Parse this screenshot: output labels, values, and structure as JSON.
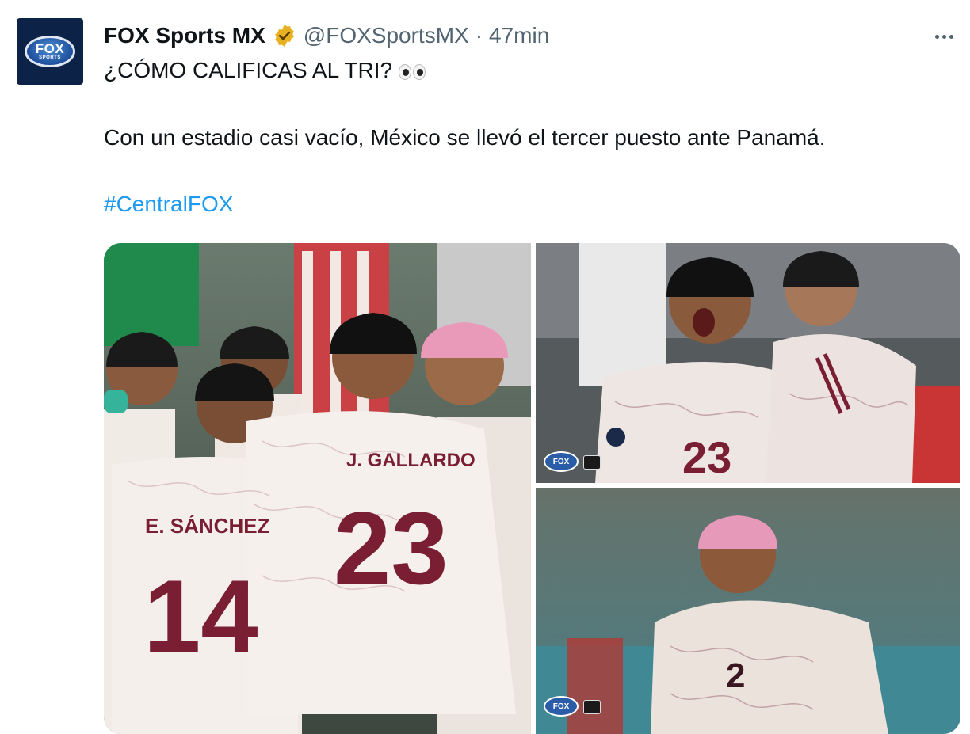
{
  "tweet": {
    "author_name": "FOX Sports MX",
    "handle": "@FOXSportsMX",
    "separator": "·",
    "time": "47min",
    "avatar_logo_text": "FOX",
    "avatar_logo_subtext": "SPORTS",
    "text_line1": "¿CÓMO CALIFICAS AL TRI?",
    "text_line1_emoji": "eyes-emoji",
    "text_line2": "Con un estadio casi vacío, México se llevó el tercer puesto ante Panamá.",
    "hashtag": "#CentralFOX"
  },
  "photos": {
    "left": {
      "jersey_name_front": "J. GALLARDO",
      "jersey_number_front": "23",
      "jersey_name_left": "E. SÁNCHEZ",
      "jersey_number_left": "14"
    },
    "top_right": {
      "jersey_number": "23",
      "watermark": "FOX"
    },
    "bottom_right": {
      "jersey_number": "2",
      "watermark": "FOX"
    }
  },
  "colors": {
    "link": "#1d9bf0",
    "secondary_text": "#536471",
    "verified_badge": "#e8b023",
    "jersey_text": "#7a1e33"
  },
  "icons": {
    "verified": "verified-badge-icon",
    "more": "more-options-icon"
  }
}
